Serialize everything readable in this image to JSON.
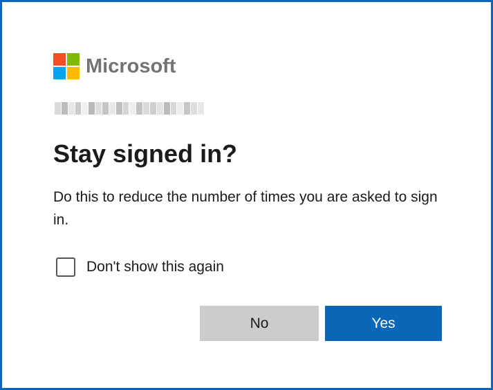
{
  "brand": {
    "name": "Microsoft",
    "logo_colors": [
      "#f25022",
      "#7fba00",
      "#00a4ef",
      "#ffb900"
    ]
  },
  "account": {
    "identity_redacted": true
  },
  "dialog": {
    "title": "Stay signed in?",
    "description": "Do this to reduce the number of times you are asked to sign in.",
    "checkbox": {
      "label": "Don't show this again",
      "checked": false
    },
    "buttons": {
      "no_label": "No",
      "yes_label": "Yes"
    }
  },
  "colors": {
    "accent": "#0a67b8",
    "secondary_button": "#cccccc",
    "text": "#1b1b1b",
    "logo_text": "#737373"
  }
}
